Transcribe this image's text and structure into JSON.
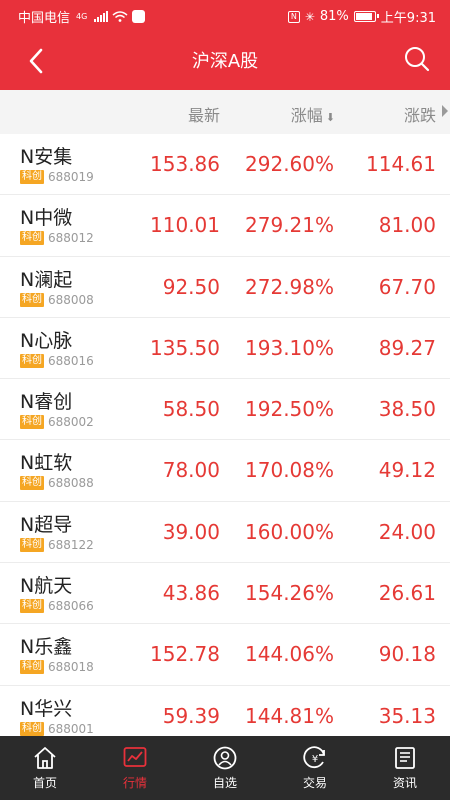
{
  "status_bar": {
    "carrier": "中国电信",
    "network": "4G",
    "battery": "81%",
    "time": "上午9:31"
  },
  "header": {
    "title": "沪深A股"
  },
  "columns": {
    "latest": "最新",
    "pct": "涨幅",
    "change": "涨跌"
  },
  "stocks": [
    {
      "name": "N安集",
      "tag": "科创",
      "code": "688019",
      "latest": "153.86",
      "pct": "292.60%",
      "change": "114.61"
    },
    {
      "name": "N中微",
      "tag": "科创",
      "code": "688012",
      "latest": "110.01",
      "pct": "279.21%",
      "change": "81.00"
    },
    {
      "name": "N澜起",
      "tag": "科创",
      "code": "688008",
      "latest": "92.50",
      "pct": "272.98%",
      "change": "67.70"
    },
    {
      "name": "N心脉",
      "tag": "科创",
      "code": "688016",
      "latest": "135.50",
      "pct": "193.10%",
      "change": "89.27"
    },
    {
      "name": "N睿创",
      "tag": "科创",
      "code": "688002",
      "latest": "58.50",
      "pct": "192.50%",
      "change": "38.50"
    },
    {
      "name": "N虹软",
      "tag": "科创",
      "code": "688088",
      "latest": "78.00",
      "pct": "170.08%",
      "change": "49.12"
    },
    {
      "name": "N超导",
      "tag": "科创",
      "code": "688122",
      "latest": "39.00",
      "pct": "160.00%",
      "change": "24.00"
    },
    {
      "name": "N航天",
      "tag": "科创",
      "code": "688066",
      "latest": "43.86",
      "pct": "154.26%",
      "change": "26.61"
    },
    {
      "name": "N乐鑫",
      "tag": "科创",
      "code": "688018",
      "latest": "152.78",
      "pct": "144.06%",
      "change": "90.18"
    },
    {
      "name": "N华兴",
      "tag": "科创",
      "code": "688001",
      "latest": "59.39",
      "pct": "144.81%",
      "change": "35.13"
    }
  ],
  "nav": [
    {
      "label": "首页",
      "icon": "home-icon",
      "active": false
    },
    {
      "label": "行情",
      "icon": "chart-icon",
      "active": true
    },
    {
      "label": "自选",
      "icon": "user-icon",
      "active": false
    },
    {
      "label": "交易",
      "icon": "yen-icon",
      "active": false
    },
    {
      "label": "资讯",
      "icon": "news-icon",
      "active": false
    }
  ],
  "colors": {
    "brand_red": "#e8313b",
    "up_red": "#e53935",
    "tag_orange": "#f5a623",
    "nav_bg": "#2b2b2b"
  }
}
